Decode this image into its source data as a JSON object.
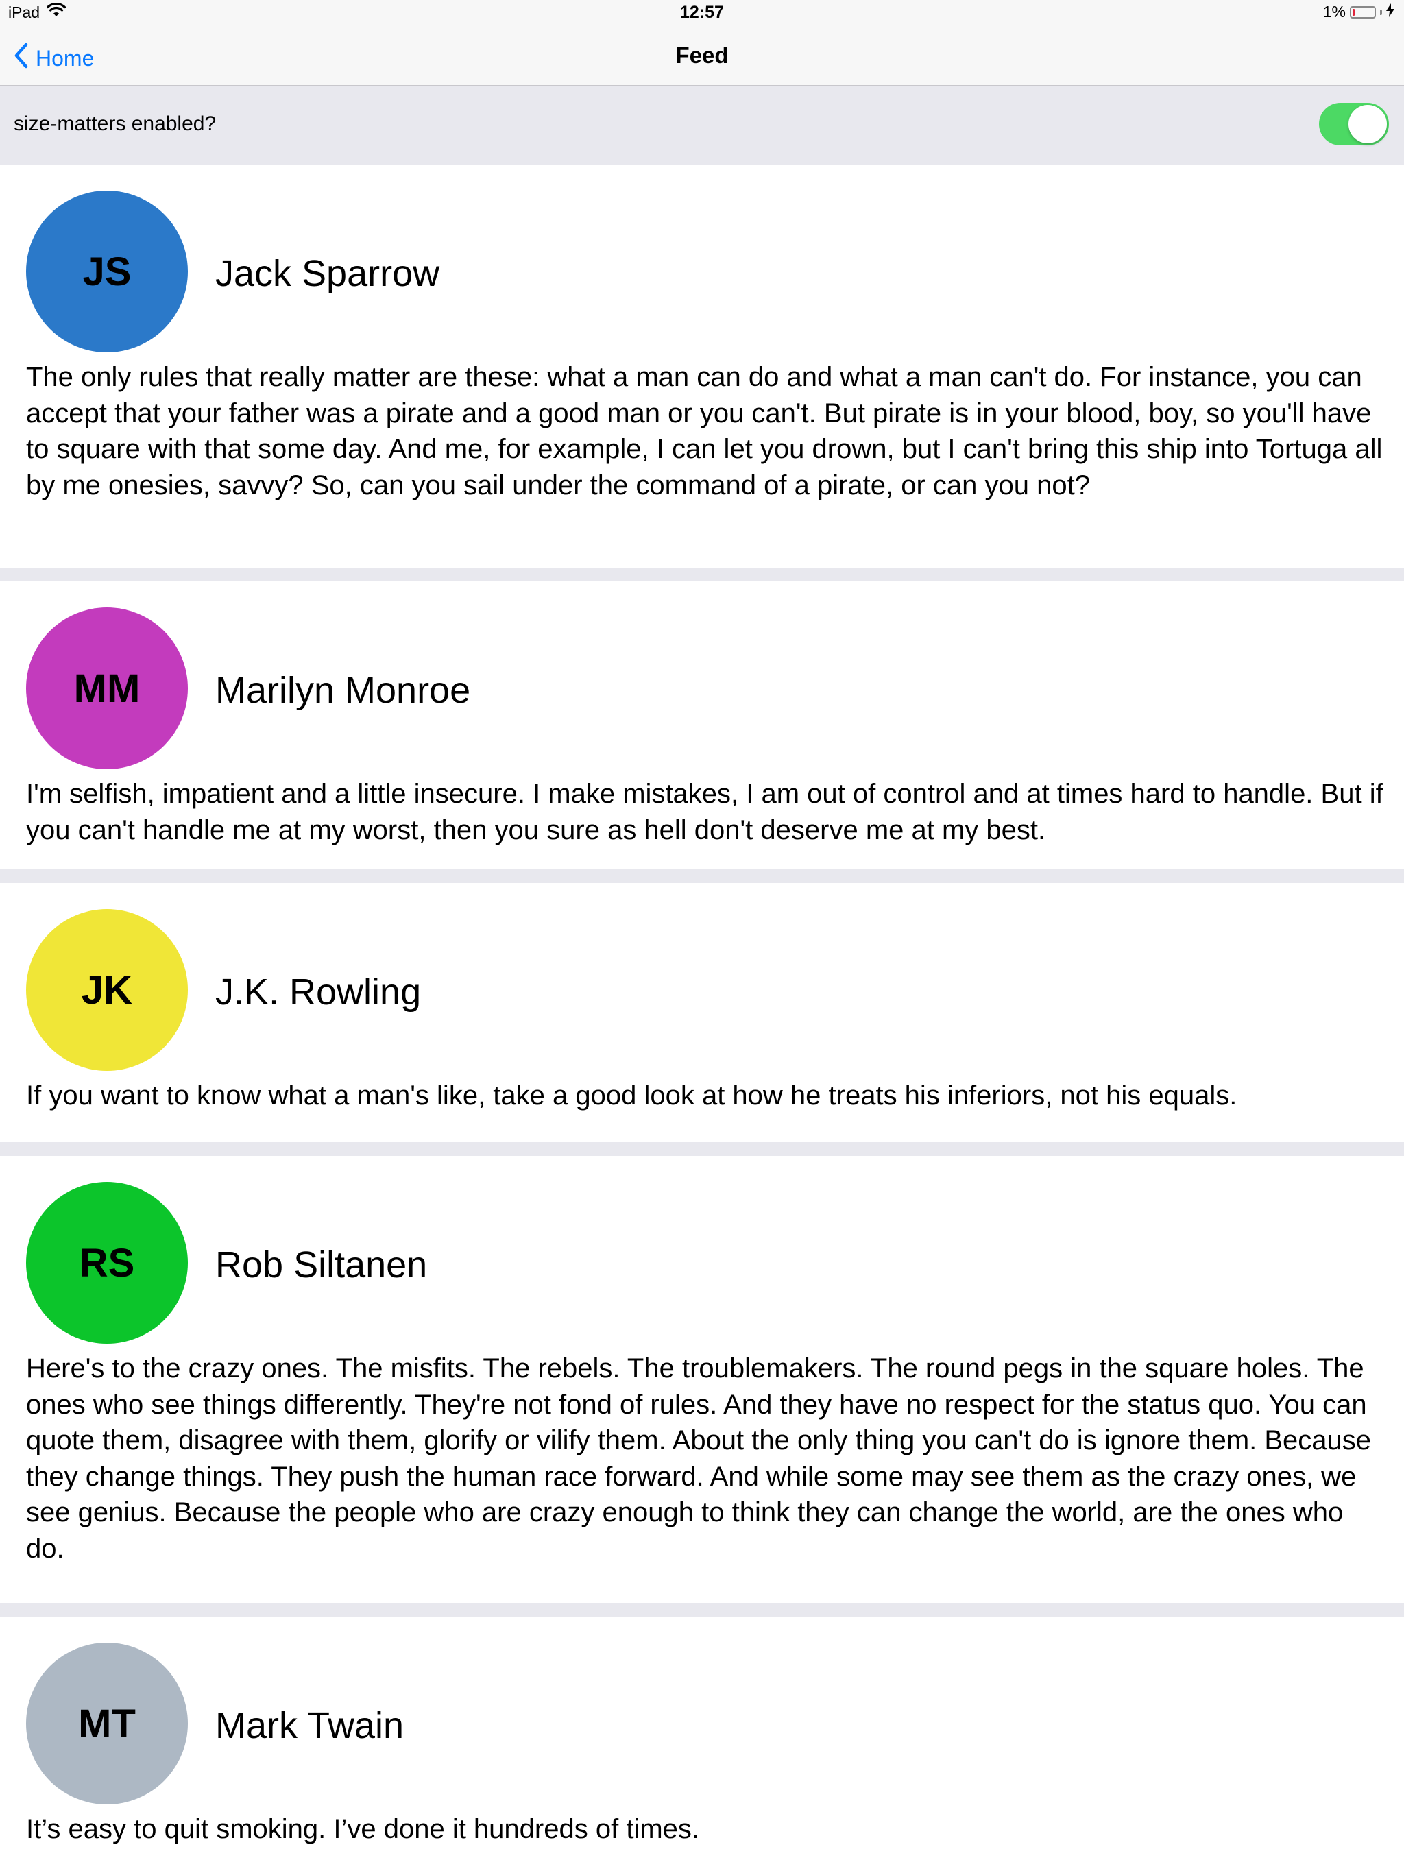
{
  "status_bar": {
    "device": "iPad",
    "time": "12:57",
    "battery": "1%"
  },
  "nav": {
    "back_label": "Home",
    "title": "Feed"
  },
  "toggle": {
    "label": "size-matters enabled?",
    "state": "on",
    "color": "#4cd964"
  },
  "posts": [
    {
      "initials": "JS",
      "name": "Jack Sparrow",
      "color": "#2b79c9",
      "quote": "The only rules that really matter are these: what a man can do and what a man can't do. For instance, you can accept that your father was a pirate and a good man or you can't. But pirate is in your blood, boy, so you'll have to square with that some day. And me, for example, I can let you drown, but I can't bring this ship into Tortuga all by me onesies, savvy? So, can you sail under the command of a pirate, or can you not?"
    },
    {
      "initials": "MM",
      "name": "Marilyn Monroe",
      "color": "#c33bbd",
      "quote": "I'm selfish, impatient and a little insecure. I make mistakes, I am out of control and at times hard to handle. But if you can't handle me at my worst, then you sure as hell don't deserve me at my best."
    },
    {
      "initials": "JK",
      "name": "J.K. Rowling",
      "color": "#f0e637",
      "quote": "If you want to know what a man's like, take a good look at how he treats his inferiors, not his equals."
    },
    {
      "initials": "RS",
      "name": "Rob Siltanen",
      "color": "#0cc52b",
      "quote": "Here's to the crazy ones. The misfits. The rebels. The troublemakers. The round pegs in the square holes. The ones who see things differently. They're not fond of rules. And they have no respect for the status quo. You can quote them, disagree with them, glorify or vilify them. About the only thing you can't do is ignore them. Because they change things. They push the human race forward. And while some may see them as the crazy ones, we see genius. Because the people who are crazy enough to think they can change the world, are the ones who do."
    },
    {
      "initials": "MT",
      "name": "Mark Twain",
      "color": "#adb8c4",
      "quote": "It’s easy to quit smoking. I’ve done it hundreds of times."
    }
  ]
}
